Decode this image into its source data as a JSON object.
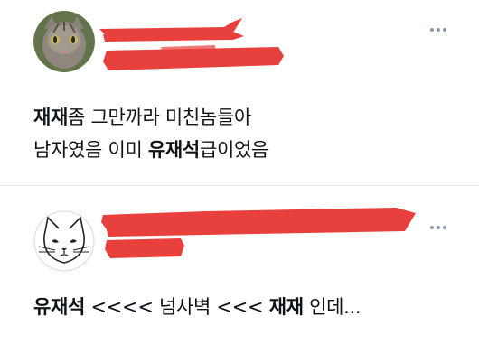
{
  "posts": [
    {
      "avatar_icon": "cat-photo-avatar",
      "more_icon": "more-options-icon",
      "lines": [
        [
          {
            "t": "재재",
            "bold": true
          },
          {
            "t": "좀 그만까라 미친놈들아",
            "bold": false
          }
        ],
        [
          {
            "t": "남자였음 이미 ",
            "bold": false
          },
          {
            "t": "유재석",
            "bold": true
          },
          {
            "t": "급이었음",
            "bold": false
          }
        ]
      ]
    },
    {
      "avatar_icon": "cat-drawing-avatar",
      "more_icon": "more-options-icon",
      "lines": [
        [
          {
            "t": "유재석",
            "bold": true
          },
          {
            "t": " <<<< 넘사벽 <<< ",
            "bold": false
          },
          {
            "t": "재재",
            "bold": true
          },
          {
            "t": " 인데...",
            "bold": false
          }
        ]
      ]
    }
  ],
  "colors": {
    "text": "#0f1419",
    "redaction": "#e8403c",
    "divider": "#e6ecf0",
    "more_dots": "#8a9aaa"
  }
}
